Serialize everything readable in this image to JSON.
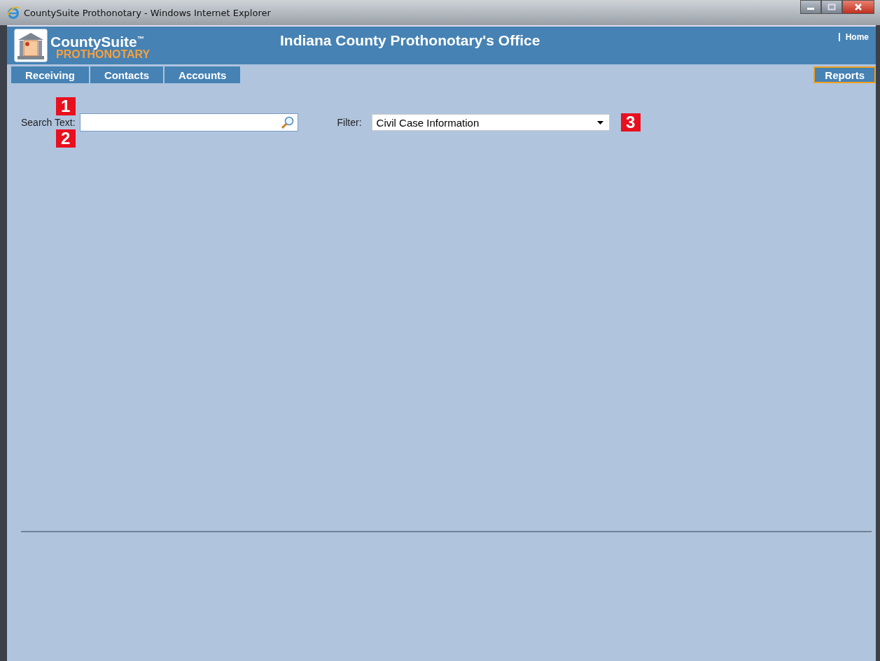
{
  "window": {
    "title": "CountySuite Prothonotary - Windows Internet Explorer"
  },
  "logo": {
    "name": "CountySuite",
    "trademark": "™",
    "product": "PROTHONOTARY"
  },
  "header": {
    "title": "Indiana County Prothonotary's Office",
    "home_link": "Home"
  },
  "tabs": [
    {
      "label": "Receiving",
      "selected": false
    },
    {
      "label": "Contacts",
      "selected": false
    },
    {
      "label": "Accounts",
      "selected": false
    }
  ],
  "right_tabs": [
    {
      "label": "Reports",
      "selected": true
    }
  ],
  "search": {
    "label": "Search Text:"
  },
  "filter": {
    "label": "Filter:",
    "value": "Civil Case Information"
  },
  "callouts": [
    "1",
    "2",
    "3"
  ]
}
